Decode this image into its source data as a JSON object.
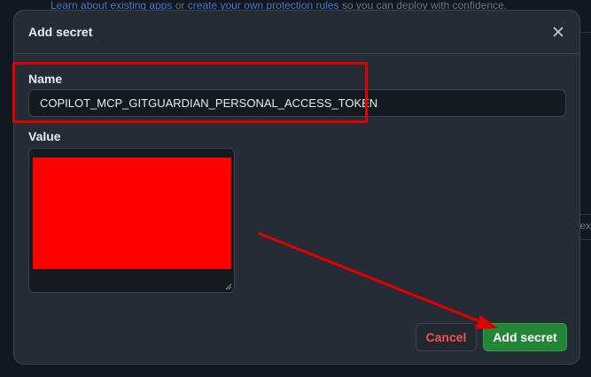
{
  "background": {
    "link1": "Learn about existing apps",
    "text1": " or ",
    "link2": "create your own protection rules",
    "text2": " so you can deploy with confidence.",
    "right_fragment": "ex"
  },
  "modal": {
    "title": "Add secret",
    "close_icon": "close-icon",
    "name_label": "Name",
    "name_value": "COPILOT_MCP_GITGUARDIAN_PERSONAL_ACCESS_TOKEN",
    "value_label": "Value",
    "value_content": "",
    "value_redacted": true,
    "cancel_label": "Cancel",
    "add_label": "Add secret"
  },
  "annotations": {
    "highlight_color": "#e00000",
    "redaction_color": "#ff0000",
    "arrow_color": "#e00000"
  },
  "colors": {
    "modal_bg": "#262c36",
    "input_bg": "#151a21",
    "primary_button": "#238636",
    "danger_text": "#f85149",
    "text": "#e6edf3"
  }
}
